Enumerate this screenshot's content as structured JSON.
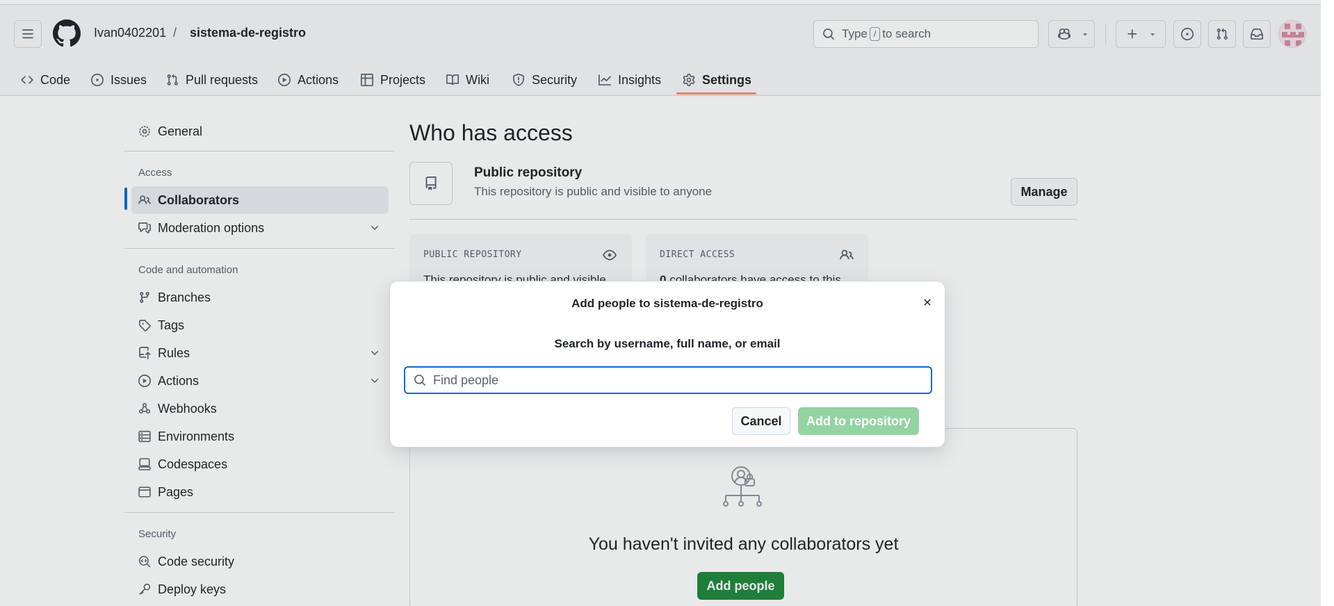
{
  "header": {
    "owner": "Ivan0402201",
    "separator": "/",
    "repo": "sistema-de-registro",
    "search_prefix": "Type",
    "search_key": "/",
    "search_suffix": "to search"
  },
  "tabs": [
    {
      "label": "Code",
      "icon": "code-icon"
    },
    {
      "label": "Issues",
      "icon": "issue-icon"
    },
    {
      "label": "Pull requests",
      "icon": "pull-request-icon"
    },
    {
      "label": "Actions",
      "icon": "play-icon"
    },
    {
      "label": "Projects",
      "icon": "table-icon"
    },
    {
      "label": "Wiki",
      "icon": "book-icon"
    },
    {
      "label": "Security",
      "icon": "shield-icon"
    },
    {
      "label": "Insights",
      "icon": "graph-icon"
    },
    {
      "label": "Settings",
      "icon": "gear-icon",
      "active": true
    }
  ],
  "sidebar": {
    "general": "General",
    "access_heading": "Access",
    "collaborators": "Collaborators",
    "moderation": "Moderation options",
    "code_heading": "Code and automation",
    "branches": "Branches",
    "tags": "Tags",
    "rules": "Rules",
    "actions": "Actions",
    "webhooks": "Webhooks",
    "environments": "Environments",
    "codespaces": "Codespaces",
    "pages": "Pages",
    "security_heading": "Security",
    "code_security": "Code security",
    "deploy_keys": "Deploy keys"
  },
  "main": {
    "title": "Who has access",
    "repo_visibility_title": "Public repository",
    "repo_visibility_desc": "This repository is public and visible to anyone",
    "manage_label": "Manage",
    "card_public_label": "PUBLIC REPOSITORY",
    "card_public_text": "This repository is public and visible",
    "card_direct_label": "DIRECT ACCESS",
    "card_direct_count": "0",
    "card_direct_text": "collaborators have access to this",
    "empty_title": "You haven't invited any collaborators yet",
    "add_people_label": "Add people"
  },
  "modal": {
    "title": "Add people to sistema-de-registro",
    "subtitle": "Search by username, full name, or email",
    "placeholder": "Find people",
    "cancel_label": "Cancel",
    "submit_label": "Add to repository"
  },
  "colors": {
    "accent": "#0969da",
    "active_tab_underline": "#fd8c73",
    "primary_button": "#1f883d",
    "primary_button_disabled": "#94d3a2"
  }
}
